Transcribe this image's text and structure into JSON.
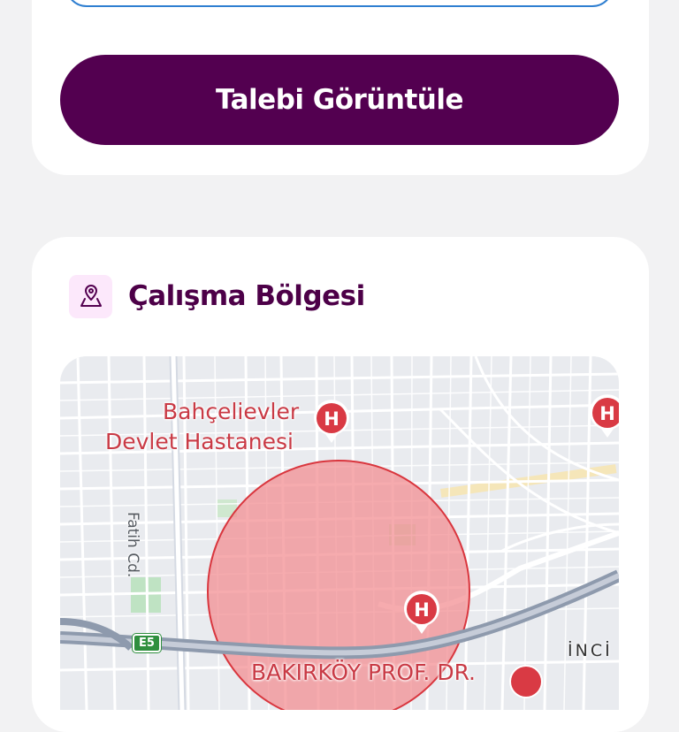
{
  "request_card": {
    "view_request_button": "Talebi Görüntüle"
  },
  "work_zone": {
    "title": "Çalışma Bölgesi",
    "icon": "map-pin-area-icon",
    "map": {
      "hospitals": [
        {
          "name_line1": "Bahçelievler",
          "name_line2": "Devlet Hastanesi"
        },
        {
          "name": "BAKIRKÖY PROF. DR."
        }
      ],
      "road_label": "Fatih Cd.",
      "highway_shield": "E5",
      "district_label": "İNCİ",
      "marker_glyph": "H",
      "colors": {
        "zone_fill": "#f28b8f",
        "zone_stroke": "#d9363e",
        "hospital_marker": "#d93a44"
      }
    }
  },
  "colors": {
    "brand_primary": "#530050",
    "title_color": "#4d0048",
    "page_background": "#f2f2f3"
  }
}
